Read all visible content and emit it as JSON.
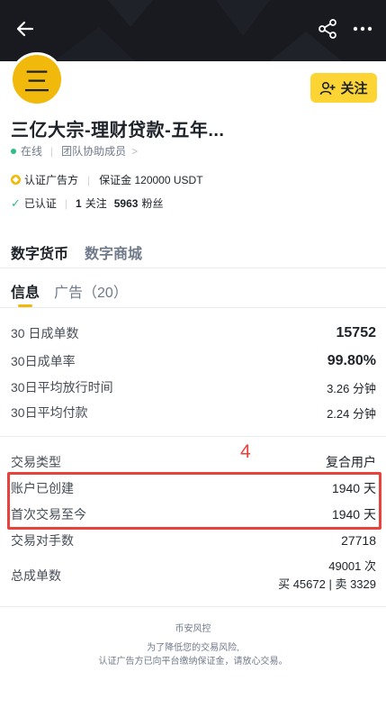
{
  "header": {
    "back_icon": "arrow-left-icon",
    "share_icon": "share-icon",
    "more_icon": "more-icon"
  },
  "profile": {
    "avatar_text": "三",
    "follow_label": "关注",
    "name": "三亿大宗-理财贷款-五年...",
    "online": "在线",
    "team": "团队协助成员",
    "team_chevron": ">",
    "certified_advertiser": "认证广告方",
    "deposit": "保证金 120000 USDT",
    "verified": "已认证",
    "following_count": "1",
    "following_label": "关注",
    "followers_count": "5963",
    "followers_label": "粉丝",
    "accent_color": "#f0b90b"
  },
  "category_tabs": [
    {
      "label": "数字货币"
    },
    {
      "label": "数字商城"
    }
  ],
  "sub_tabs": [
    {
      "label": "信息"
    },
    {
      "label": "广告（20）"
    }
  ],
  "stats": [
    {
      "label": "30 日成单数",
      "value": "15752"
    },
    {
      "label": "30日成单率",
      "value": "99.80%"
    },
    {
      "label": "30日平均放行时间",
      "value": "3.26 分钟"
    },
    {
      "label": "30日平均付款",
      "value": "2.24 分钟"
    }
  ],
  "details": [
    {
      "label": "交易类型",
      "value": "复合用户"
    },
    {
      "label": "账户已创建",
      "value": "1940 天"
    },
    {
      "label": "首次交易至今",
      "value": "1940 天"
    },
    {
      "label": "交易对手数",
      "value": "27718"
    }
  ],
  "total": {
    "label": "总成单数",
    "value": "49001 次",
    "breakdown": "买 45672 | 卖 3329"
  },
  "annotation": {
    "number": "4",
    "color": "#e8423d"
  },
  "footer": {
    "title": "币安风控",
    "line1": "为了降低您的交易风险,",
    "line2": "认证广告方已向平台缴纳保证金，请放心交易。"
  }
}
